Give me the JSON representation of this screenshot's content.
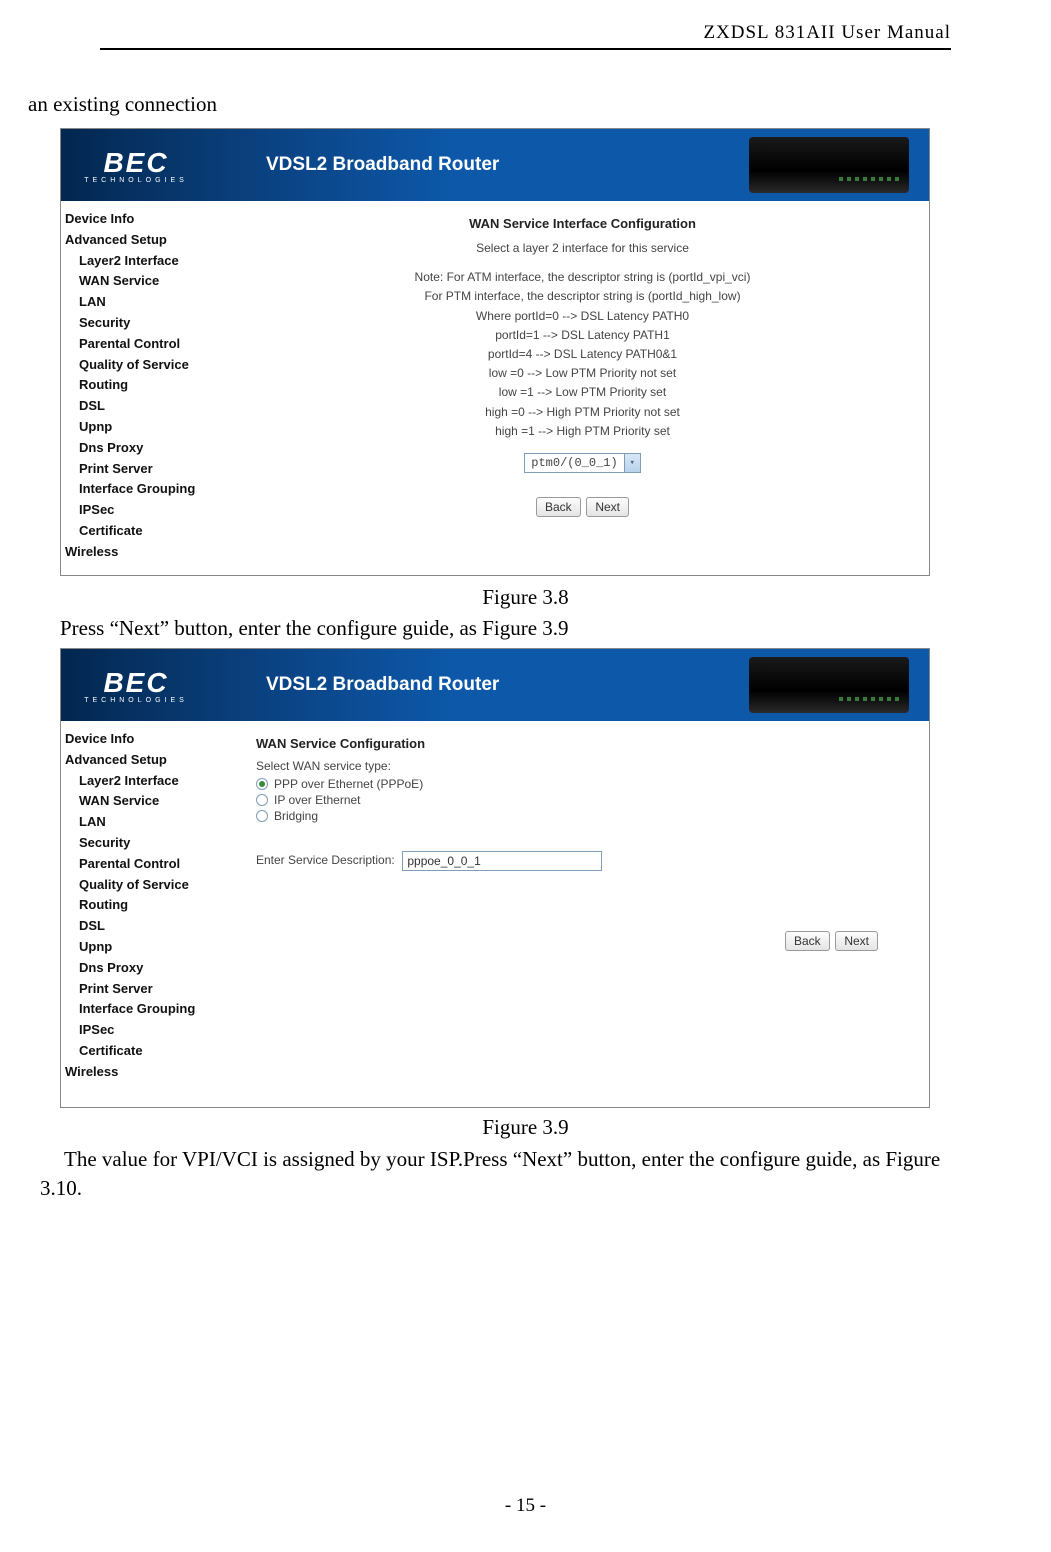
{
  "header": {
    "doc_title": "ZXDSL 831AII User Manual"
  },
  "page_number": "- 15 -",
  "text": {
    "intro": "an existing connection",
    "caption_38": "Figure 3.8",
    "after_38": "Press “Next” button, enter the configure guide, as Figure 3.9",
    "caption_39": "Figure 3.9",
    "after_39": "The value for VPI/VCI is assigned by your ISP.Press “Next” button, enter the configure guide, as Figure 3.10."
  },
  "brand": {
    "logo_main": "BEC",
    "logo_sub": "TECHNOLOGIES",
    "product": "VDSL2 Broadband Router"
  },
  "sidebar": {
    "items": [
      "Device Info",
      "Advanced Setup",
      "Wireless"
    ],
    "adv_sub": [
      "Layer2 Interface",
      "WAN Service",
      "LAN",
      "Security",
      "Parental Control",
      "Quality of Service",
      "Routing",
      "DSL",
      "Upnp",
      "Dns Proxy",
      "Print Server",
      "Interface Grouping",
      "IPSec",
      "Certificate"
    ]
  },
  "fig38": {
    "title": "WAN Service Interface Configuration",
    "sub": "Select a layer 2 interface for this service",
    "notes": [
      "Note: For ATM interface, the descriptor string is (portId_vpi_vci)",
      "For PTM interface, the descriptor string is (portId_high_low)",
      "Where portId=0 --> DSL Latency PATH0",
      "portId=1 --> DSL Latency PATH1",
      "portId=4 --> DSL Latency PATH0&1",
      "low =0 --> Low PTM Priority not set",
      "low =1 --> Low PTM Priority set",
      "high =0 --> High PTM Priority not set",
      "high =1 --> High PTM Priority set"
    ],
    "select_value": "ptm0/(0_0_1)",
    "back": "Back",
    "next": "Next"
  },
  "fig39": {
    "title": "WAN Service Configuration",
    "sub": "Select WAN service type:",
    "opts": [
      "PPP over Ethernet (PPPoE)",
      "IP over Ethernet",
      "Bridging"
    ],
    "desc_label": "Enter Service Description:",
    "desc_value": "pppoe_0_0_1",
    "back": "Back",
    "next": "Next"
  }
}
